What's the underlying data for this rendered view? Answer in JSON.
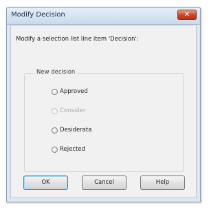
{
  "dialog": {
    "title": "Modify Decision",
    "close_label": "✕",
    "prompt": "Modify a selection list line item 'Decision':"
  },
  "group": {
    "label": "New decision",
    "options": [
      {
        "label": "Approved",
        "enabled": true,
        "selected": false
      },
      {
        "label": "Consider",
        "enabled": false,
        "selected": false
      },
      {
        "label": "Desiderata",
        "enabled": true,
        "selected": false
      },
      {
        "label": "Rejected",
        "enabled": true,
        "selected": false
      }
    ]
  },
  "buttons": {
    "ok": "OK",
    "cancel": "Cancel",
    "help": "Help"
  },
  "colors": {
    "frame": "#dfe8f2",
    "close_button": "#c8432b",
    "client_background": "#f1f1f1",
    "disabled_text": "#a8a8a8"
  }
}
